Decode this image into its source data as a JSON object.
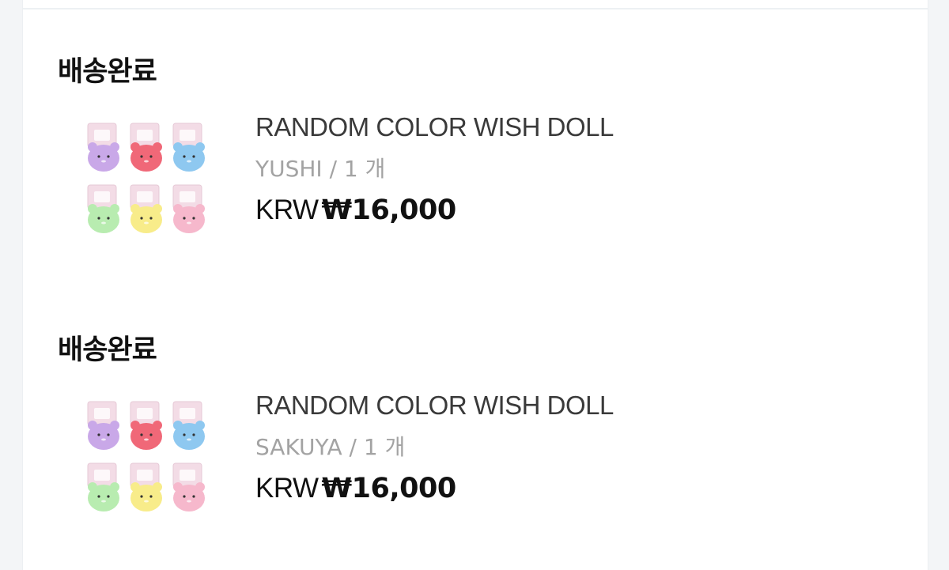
{
  "orders": [
    {
      "status": "배송완료",
      "product_name": "RANDOM COLOR WISH DOLL",
      "option": "YUSHI / 1 개",
      "currency": "KRW",
      "price": "₩16,000",
      "thumbnail": "wish-doll-color-set-image"
    },
    {
      "status": "배송완료",
      "product_name": "RANDOM COLOR WISH DOLL",
      "option": "SAKUYA / 1 개",
      "currency": "KRW",
      "price": "₩16,000",
      "thumbnail": "wish-doll-color-set-image"
    }
  ],
  "doll_colors": [
    "#c9a8e8",
    "#f06878",
    "#8ec8f0",
    "#b8ecb0",
    "#f8ec8a",
    "#f6b8cc"
  ],
  "box_color": "#f3dce6"
}
